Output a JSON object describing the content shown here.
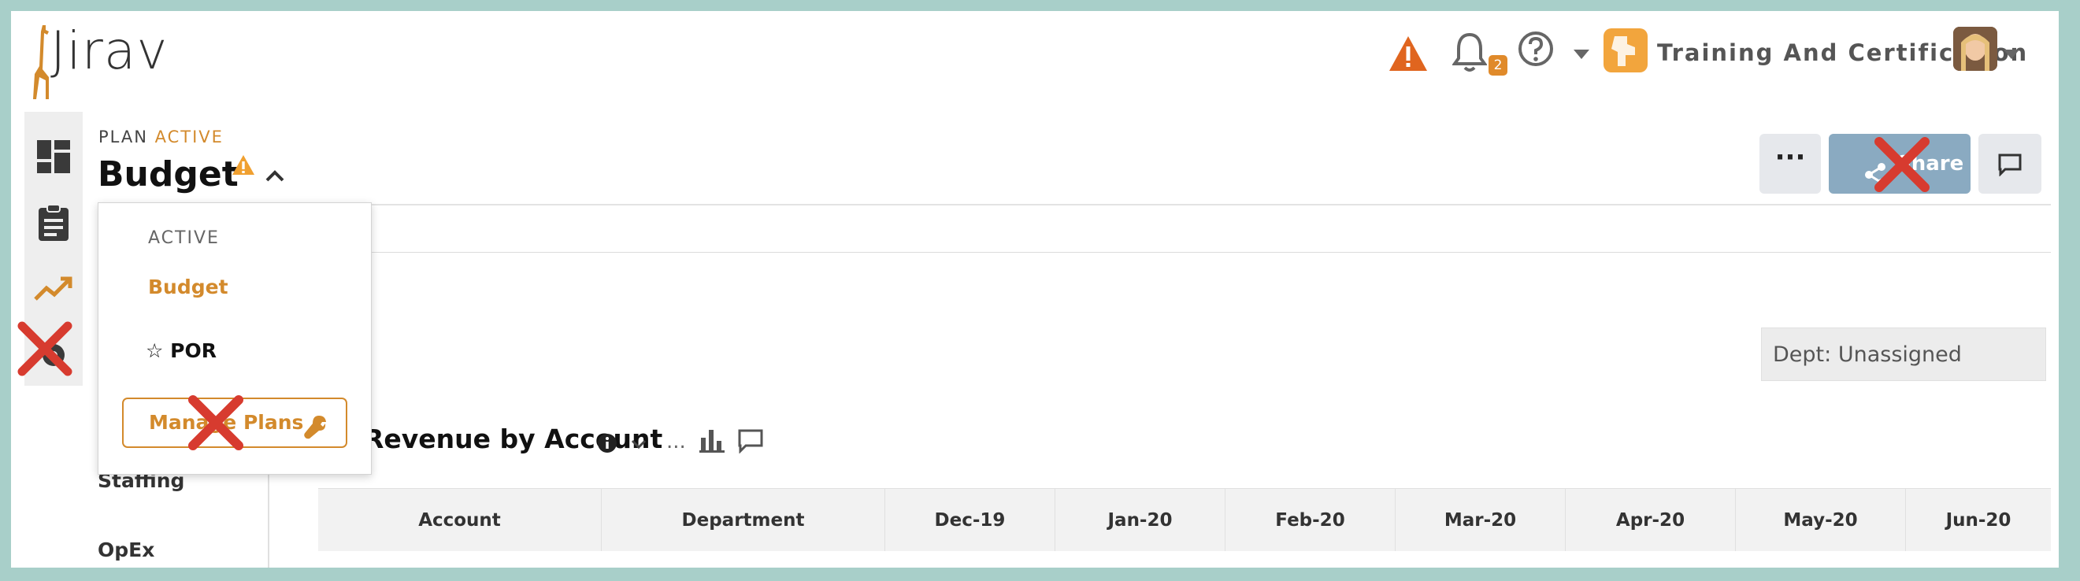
{
  "header": {
    "logo": "Jirav",
    "org_name": "Training And Certification",
    "notification_count": "2",
    "icons": [
      "warning-icon",
      "bell-icon",
      "help-icon",
      "chevron-down-icon",
      "org-logo-icon",
      "avatar"
    ]
  },
  "left_nav": {
    "items": [
      "dashboard-icon",
      "clipboard-icon",
      "trend-icon",
      "settings-icon"
    ]
  },
  "plan": {
    "label": "PLAN",
    "status": "ACTIVE",
    "title": "Budget"
  },
  "actions": {
    "more": "···",
    "share": "Share"
  },
  "dropdown": {
    "header": "ACTIVE",
    "items": [
      "Budget",
      "☆ POR"
    ],
    "manage_button": "Manage Plans"
  },
  "filters": {
    "dept_label": "Dept:",
    "dept_value": "Unassigned"
  },
  "report": {
    "title": "Revenue by Account",
    "ellipsis": "..."
  },
  "left_sections": [
    "Staffing",
    "OpEx"
  ],
  "table": {
    "columns": [
      "Account",
      "Department",
      "Dec-19",
      "Jan-20",
      "Feb-20",
      "Mar-20",
      "Apr-20",
      "May-20",
      "Jun-20"
    ]
  },
  "colors": {
    "accent": "#d38a2c",
    "share_button": "#8aaac1",
    "frame": "#a8cfc9",
    "warning": "#e0651f"
  }
}
